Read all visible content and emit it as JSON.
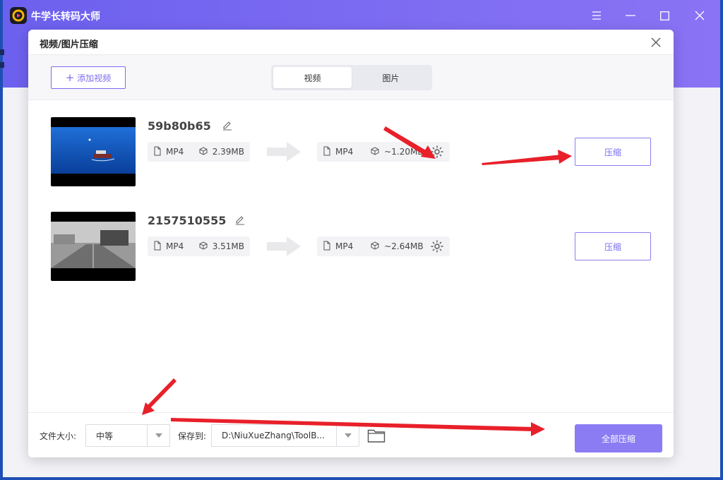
{
  "app": {
    "title": "牛学长转码大师"
  },
  "dialog": {
    "title": "视频/图片压缩"
  },
  "toolbar": {
    "add_video_label": "添加视频",
    "tabs": [
      {
        "label": "视频",
        "active": true
      },
      {
        "label": "图片",
        "active": false
      }
    ]
  },
  "files": [
    {
      "name": "59b80b65",
      "source": {
        "format": "MP4",
        "size": "2.39MB"
      },
      "output": {
        "format": "MP4",
        "size": "~1.20MB"
      },
      "compress_label": "压缩"
    },
    {
      "name": "2157510555",
      "source": {
        "format": "MP4",
        "size": "3.51MB"
      },
      "output": {
        "format": "MP4",
        "size": "~2.64MB"
      },
      "compress_label": "压缩"
    }
  ],
  "footer": {
    "file_size_label": "文件大小:",
    "file_size_value": "中等",
    "save_to_label": "保存到:",
    "save_path": "D:\\NiuXueZhang\\ToolB...",
    "compress_all_label": "全部压缩"
  },
  "colors": {
    "accent": "#7a6cf0",
    "titlebar": "#7d6cf2",
    "annotation": "#e8202a"
  }
}
